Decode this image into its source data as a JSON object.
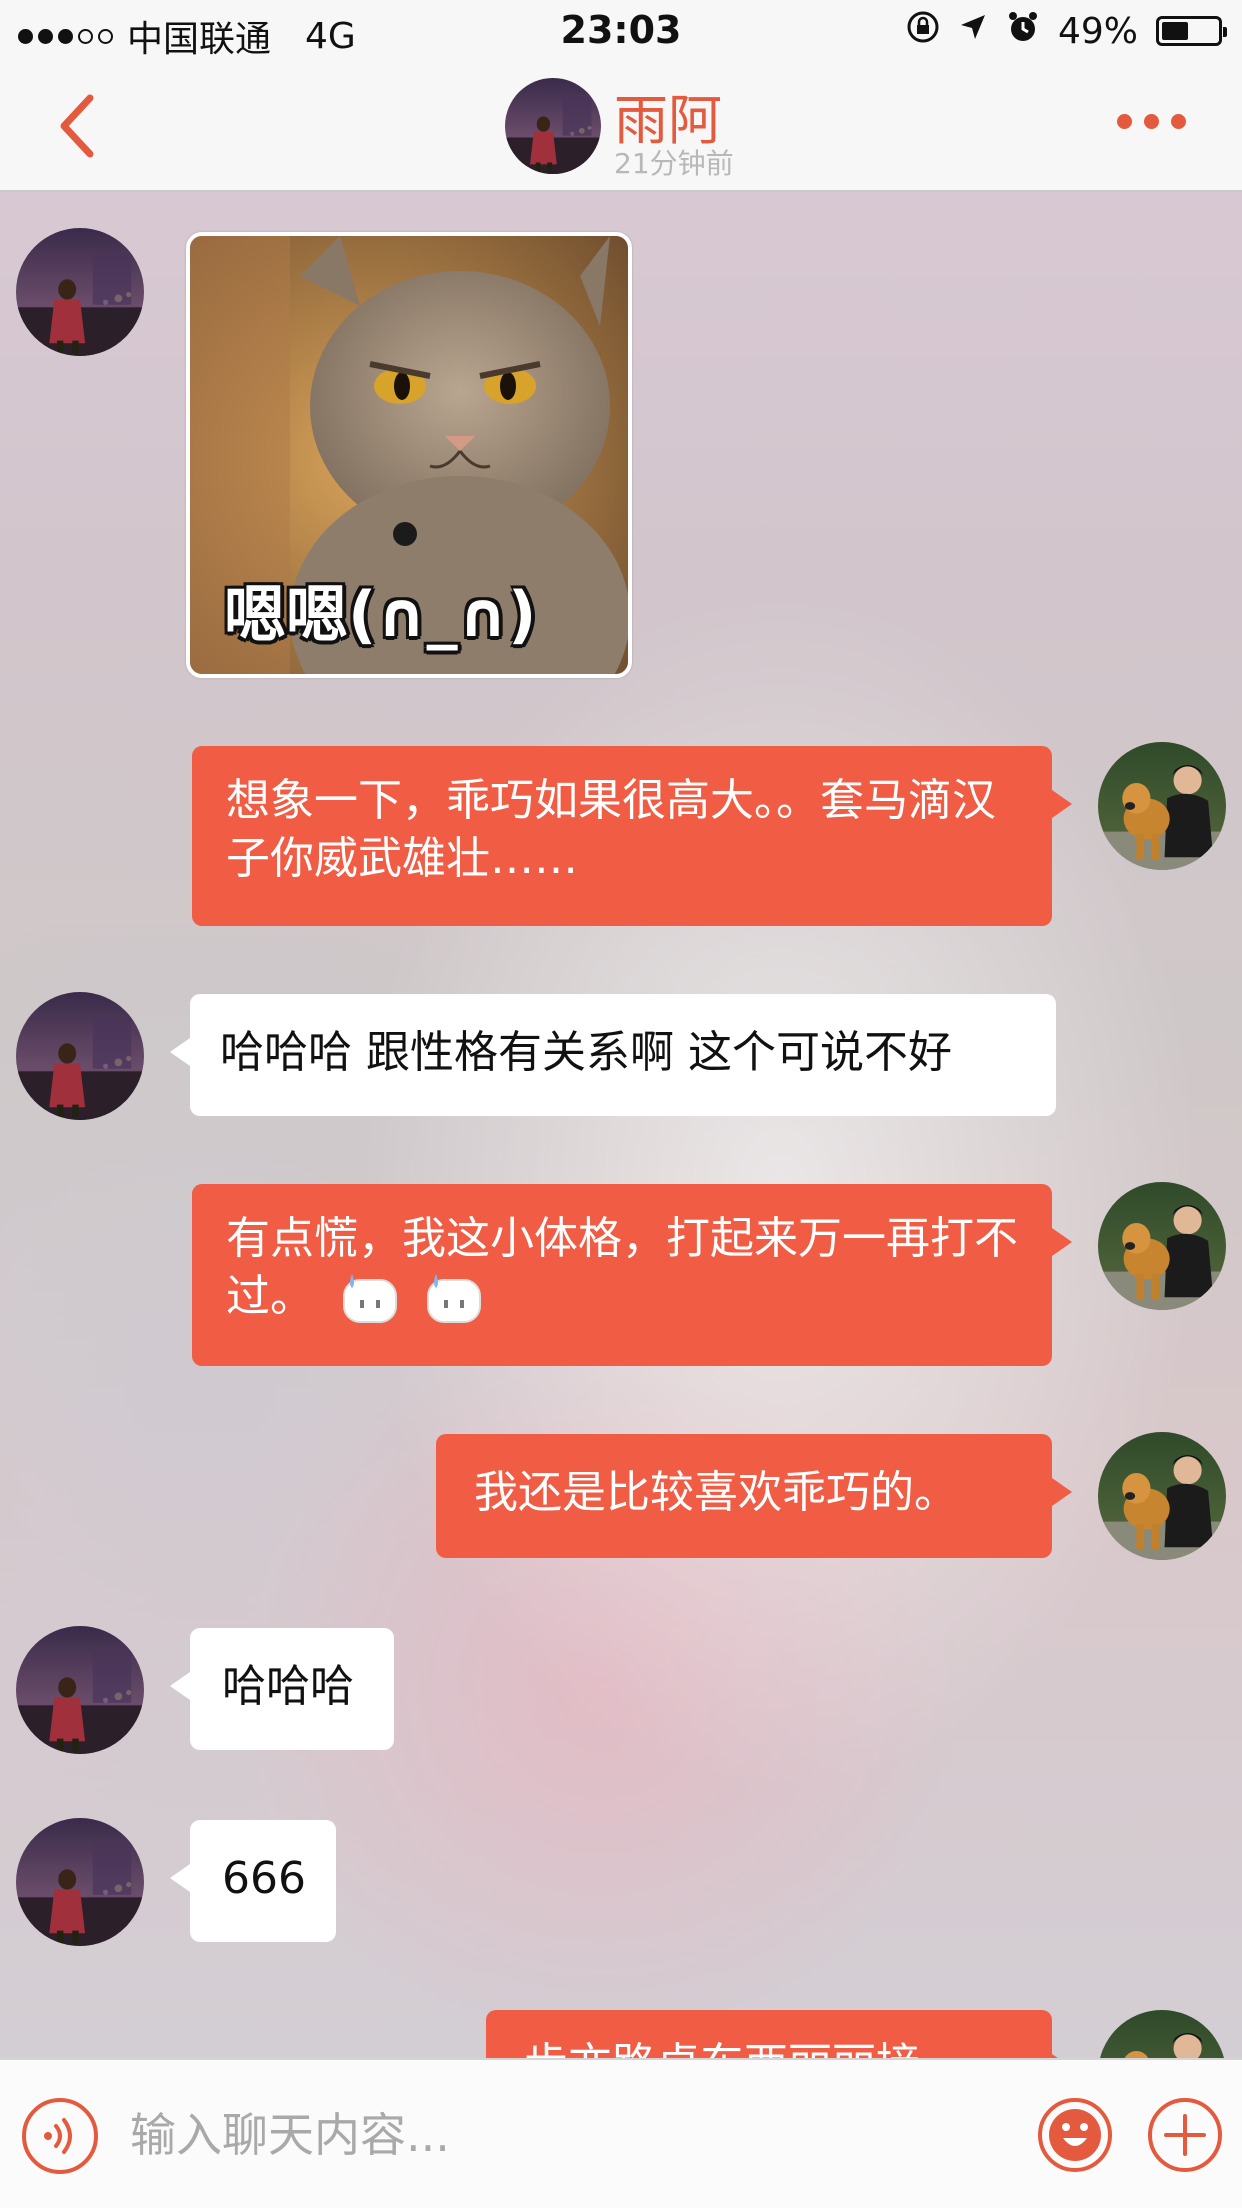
{
  "status_bar": {
    "carrier": "中国联通",
    "network": "4G",
    "time": "23:03",
    "battery": "49%",
    "battery_level": 0.49
  },
  "header": {
    "contact_name": "雨阿",
    "last_seen": "21分钟前"
  },
  "messages": [
    {
      "side": "in",
      "type": "sticker",
      "caption": "嗯嗯(∩_∩)"
    },
    {
      "side": "out",
      "text": "想象一下，乖巧如果很高大。。套马滴汉子你威武雄壮……"
    },
    {
      "side": "in",
      "text": "哈哈哈 跟性格有关系啊 这个可说不好"
    },
    {
      "side": "out",
      "text": "有点慌，我这小体格，打起来万一再打不过。"
    },
    {
      "side": "out",
      "text": "我还是比较喜欢乖巧的。"
    },
    {
      "side": "in",
      "text": "哈哈哈"
    },
    {
      "side": "in",
      "text": "666"
    },
    {
      "side": "out",
      "text": "步亦路卓东西丽丽接"
    }
  ],
  "input": {
    "placeholder": "输入聊天内容..."
  },
  "icons": {
    "back": "chevron-left-icon",
    "more": "more-dots-icon",
    "voice": "voice-icon",
    "emoji": "emoji-icon",
    "plus": "plus-icon"
  },
  "colors": {
    "accent": "#e45a3e",
    "outgoing_bubble": "#f15c45",
    "incoming_bubble": "#ffffff"
  }
}
